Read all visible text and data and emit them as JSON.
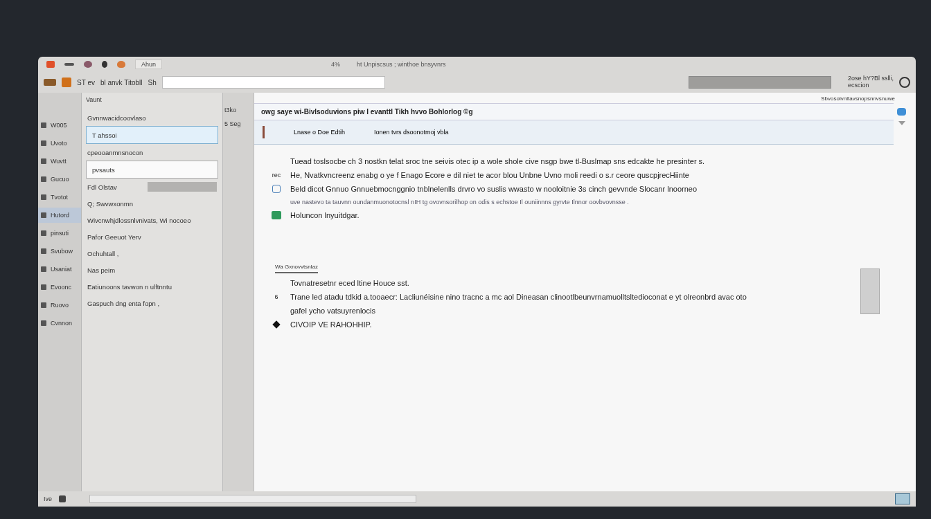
{
  "title_bar": {
    "field": "Ahun",
    "zoom": "4%",
    "title": "ht Unpiscsus ; winthoe bnsyvnrs"
  },
  "toolbar": {
    "labels": [
      "ST ev",
      "bl anvk Titobll",
      "Sh"
    ],
    "account": "2ose hY?Bl sslli,",
    "account_sub": "ecscion"
  },
  "nav": [
    {
      "label": "W005",
      "selected": false
    },
    {
      "label": "Uvoto",
      "selected": false
    },
    {
      "label": "Wuvtt",
      "selected": false
    },
    {
      "label": "Gucuo",
      "selected": false
    },
    {
      "label": "Tvotot",
      "selected": false
    },
    {
      "label": "Hutord",
      "selected": true
    },
    {
      "label": "pinsuti",
      "selected": false
    },
    {
      "label": "Svubow",
      "selected": false
    },
    {
      "label": "Usaniat",
      "selected": false
    },
    {
      "label": "Evoonc",
      "selected": false
    },
    {
      "label": "Ruovo",
      "selected": false
    },
    {
      "label": "Cvnnon",
      "selected": false
    }
  ],
  "folders": {
    "header": "Vaunt",
    "items": [
      {
        "kind": "plain",
        "label": "Gvnnwacidcoovlaso",
        "selected": false
      },
      {
        "kind": "field",
        "label": "T ahssoi",
        "selected": true
      },
      {
        "kind": "plain",
        "label": "cpeooanmnsnocon",
        "selected": false
      },
      {
        "kind": "field",
        "label": "pvsauts",
        "selected": false
      },
      {
        "kind": "bar",
        "label": "Fdl Olstav",
        "selected": false
      },
      {
        "kind": "plain",
        "label": "Q; Swvwxonmn",
        "selected": false
      },
      {
        "kind": "plain",
        "label": "Wivcnwhjdlossnlvnivats, Wi nocoeo",
        "selected": false
      },
      {
        "kind": "plain",
        "label": "Pafor Geeuot Yerv",
        "selected": false
      },
      {
        "kind": "plain",
        "label": "Ochuhtall ,",
        "selected": false
      },
      {
        "kind": "plain",
        "label": "Nas peim",
        "selected": false
      },
      {
        "kind": "plain",
        "label": "Eatiunoons tavwon n ulftnntu",
        "selected": false
      },
      {
        "kind": "plain",
        "label": "Gaspuch dng enta fopn ,",
        "selected": false
      }
    ]
  },
  "counts": [
    "t3ko",
    "5 Seg"
  ],
  "message": {
    "top_note": "Sbvosolvnltavsnopsnnvsnuwe",
    "subject": "owg saye wi-Bivlsoduvions piw I evanttl Tikh hvvo Bohlorlog ©g",
    "from": "Lnase o Doe Edtih",
    "date": "Ionen tvrs dsoonotmoj vbla",
    "lines": [
      {
        "kind": "plain",
        "text": "Tuead toslsocbe ch 3 nostkn telat sroc tne seivis otec ip a wole shole cive nsgp bwe tl-Buslmap sns edcakte he presinter s."
      },
      {
        "kind": "label",
        "label": "rec",
        "text": "He, Nvatkvncreenz enabg o ye f Enago Ecore e dil niet te acor blou Unbne Uvno moli reedi o s.r ceore quscpjrecHiinte"
      },
      {
        "kind": "doc",
        "text": "Beld dicot Gnnuo Gnnuebmocnggnio tnblnelenlls drvro vo suslis wwasto w nooloitnie 3s cinch gevvnde Slocanr lnoorneo"
      },
      {
        "kind": "faint",
        "text": "uve nastevo ta tauvnn oundanmuonotocnsl nIH tg ovovnsorilhop on odis s echstoe Il ouniinnns gyrvte Ilnnor oovbvovnsse ."
      },
      {
        "kind": "image",
        "text": "Holuncon lnyuitdgar."
      }
    ],
    "section": "Wa Gxnovvtsnlaz",
    "lines2": [
      {
        "kind": "plain",
        "text": "Tovnatresetnr eced ltine Houce sst."
      },
      {
        "kind": "number",
        "label": "6",
        "text": "Trane led atadu tdkid a.tooaecr: Lacliunéisine nino  tracnc a mc aol Dineasan clinootlbeunvrnamuolltsltedioconat e yt  olreonbrd avac oto"
      },
      {
        "kind": "plain",
        "text": "gafel ycho vatsuyrenlocis"
      },
      {
        "kind": "diamond",
        "text": "CIVOIP VE RAHOHHIP."
      }
    ]
  },
  "status": {
    "label": "Ive"
  }
}
